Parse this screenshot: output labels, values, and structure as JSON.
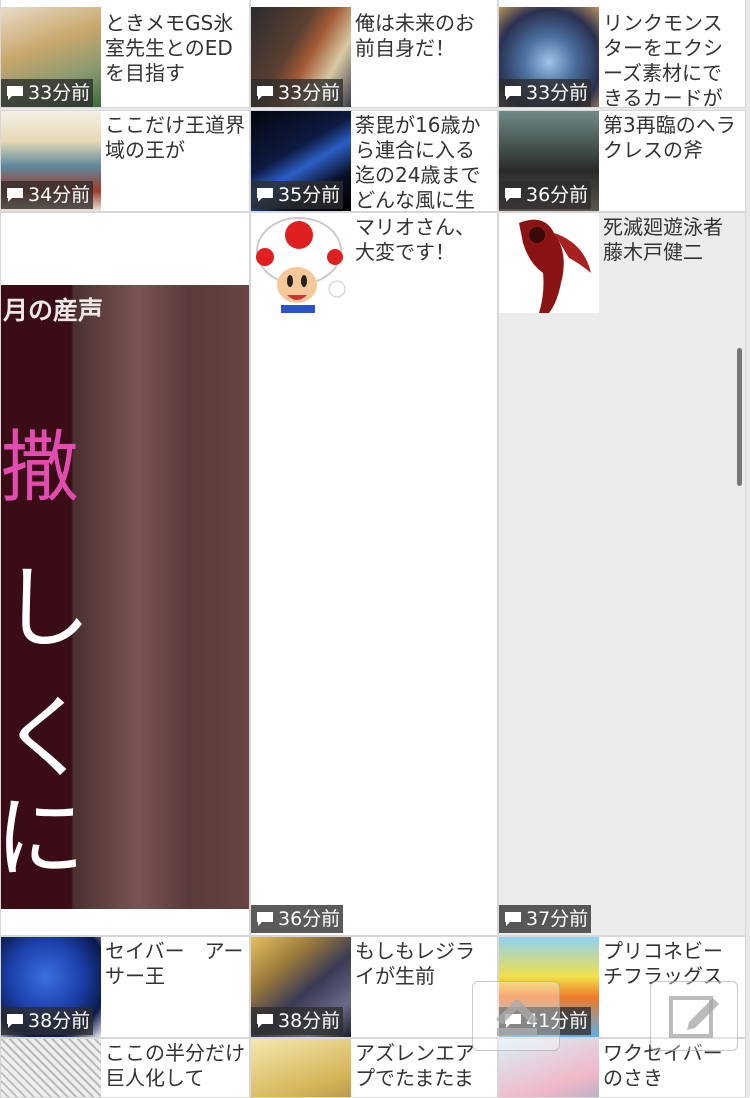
{
  "threads": [
    {
      "id": "r0c0",
      "title": "ときメモGS氷室先生とのEDを目指す",
      "time": "33分前",
      "thumb": "anime-portrait"
    },
    {
      "id": "r0c1",
      "title": "俺は未来のお前自身だ！",
      "time": "33分前",
      "thumb": "two-anime-men"
    },
    {
      "id": "r0c2",
      "title": "リンクモンスターをエクシーズ素材にできるカードが",
      "time": "33分前",
      "thumb": "card-art"
    },
    {
      "id": "r1c0",
      "title": "ここだけ王道界域の王が",
      "time": "34分前",
      "thumb": "fantasy-king"
    },
    {
      "id": "r1c1",
      "title": "荼毘が16歳から連合に入る迄の24歳までどんな風に生",
      "time": "35分前",
      "thumb": "dark-anime"
    },
    {
      "id": "r1c2",
      "title": "第3再臨のヘラクレスの斧",
      "time": "36分前",
      "thumb": "armored-warrior"
    },
    {
      "id": "r2c1",
      "title": "マリオさん、大変です！",
      "time": "36分前",
      "thumb": "toad"
    },
    {
      "id": "r2c2",
      "title": "死滅廻遊泳者　藤木戸健二",
      "time": "37分前",
      "thumb": "red-figure"
    },
    {
      "id": "r3c0",
      "title": "セイバー　アーサー王",
      "time": "38分前",
      "thumb": "blue-hedgehog"
    },
    {
      "id": "r3c1",
      "title": "もしもレジライが生前",
      "time": "38分前",
      "thumb": "knight-anime"
    },
    {
      "id": "r3c2",
      "title": "プリコネビーチフラッグス",
      "time": "41分前",
      "thumb": "beach-banner"
    },
    {
      "id": "r4c0",
      "title": "ここの半分だけ巨人化して",
      "time": "",
      "thumb": "manga-panel"
    },
    {
      "id": "r4c1",
      "title": "アズレンエアプでたまたま",
      "time": "",
      "thumb": "blonde-anime"
    },
    {
      "id": "r4c2",
      "title": "ワクセイバーのさき",
      "time": "",
      "thumb": "cosplay"
    }
  ],
  "ad": {
    "text_top": "月の産声",
    "char_big": "撒",
    "char2": "し",
    "char3": "く",
    "char4": "に"
  },
  "icons": {
    "comment": "comment-bubble-icon",
    "scroll_top": "scroll-top-icon",
    "compose": "compose-icon"
  }
}
